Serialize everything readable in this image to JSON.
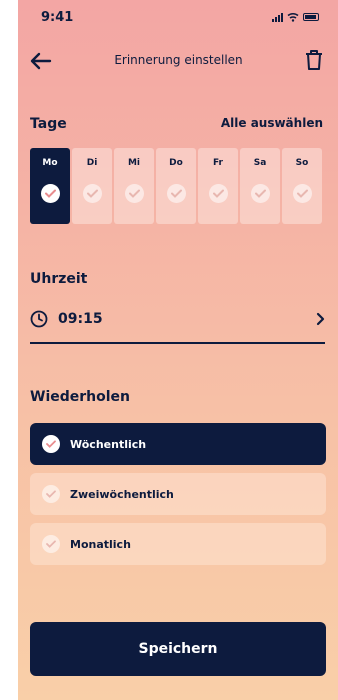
{
  "status": {
    "time": "9:41"
  },
  "header": {
    "title": "Erinnerung einstellen"
  },
  "days_section": {
    "label": "Tage",
    "select_all": "Alle auswählen",
    "days": [
      {
        "label": "Mo",
        "selected": true
      },
      {
        "label": "Di",
        "selected": false
      },
      {
        "label": "Mi",
        "selected": false
      },
      {
        "label": "Do",
        "selected": false
      },
      {
        "label": "Fr",
        "selected": false
      },
      {
        "label": "Sa",
        "selected": false
      },
      {
        "label": "So",
        "selected": false
      }
    ]
  },
  "time_section": {
    "label": "Uhrzeit",
    "value": "09:15"
  },
  "repeat_section": {
    "label": "Wiederholen",
    "options": [
      {
        "label": "Wöchentlich",
        "selected": true
      },
      {
        "label": "Zweiwöchentlich",
        "selected": false
      },
      {
        "label": "Monatlich",
        "selected": false
      }
    ]
  },
  "save_label": "Speichern",
  "colors": {
    "primary": "#0d1b3e",
    "selected_check": "#e88d8f",
    "unselected_check": "#e8b7b0"
  }
}
